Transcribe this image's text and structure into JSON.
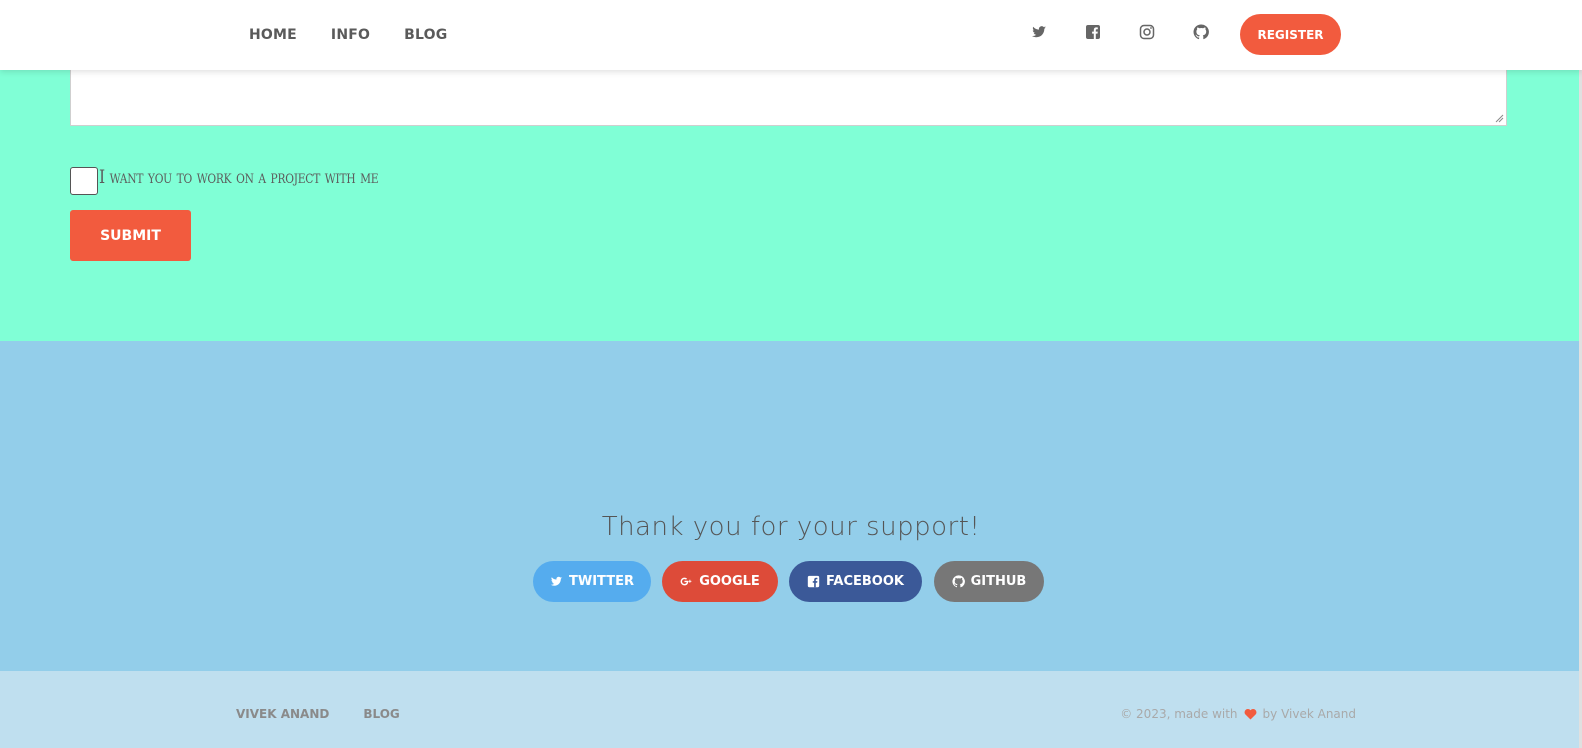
{
  "navbar": {
    "links": [
      "HOME",
      "INFO",
      "BLOG"
    ],
    "icons": [
      "twitter-icon",
      "facebook-icon",
      "instagram-icon",
      "github-icon"
    ],
    "register_label": "REGISTER"
  },
  "form": {
    "checkbox_label": "I want you to work on a project with me",
    "submit_label": "SUBMIT"
  },
  "support": {
    "title": "Thank you for your support!",
    "buttons": [
      {
        "label": "TWITTER",
        "icon": "twitter-icon",
        "color": "#55acee"
      },
      {
        "label": "GOOGLE",
        "icon": "google-plus-icon",
        "color": "#dd4b39"
      },
      {
        "label": "FACEBOOK",
        "icon": "facebook-icon",
        "color": "#3b5998"
      },
      {
        "label": "GITHUB",
        "icon": "github-icon",
        "color": "#777777"
      }
    ]
  },
  "footer": {
    "links": [
      "VIVEK ANAND",
      "BLOG"
    ],
    "copyright_prefix": "© 2023, made with",
    "copyright_suffix": "by Vivek Anand"
  },
  "colors": {
    "accent": "#f25b3e",
    "form_bg": "#80ffd6",
    "support_bg": "#93ceea",
    "footer_bg": "#bfdfef"
  }
}
